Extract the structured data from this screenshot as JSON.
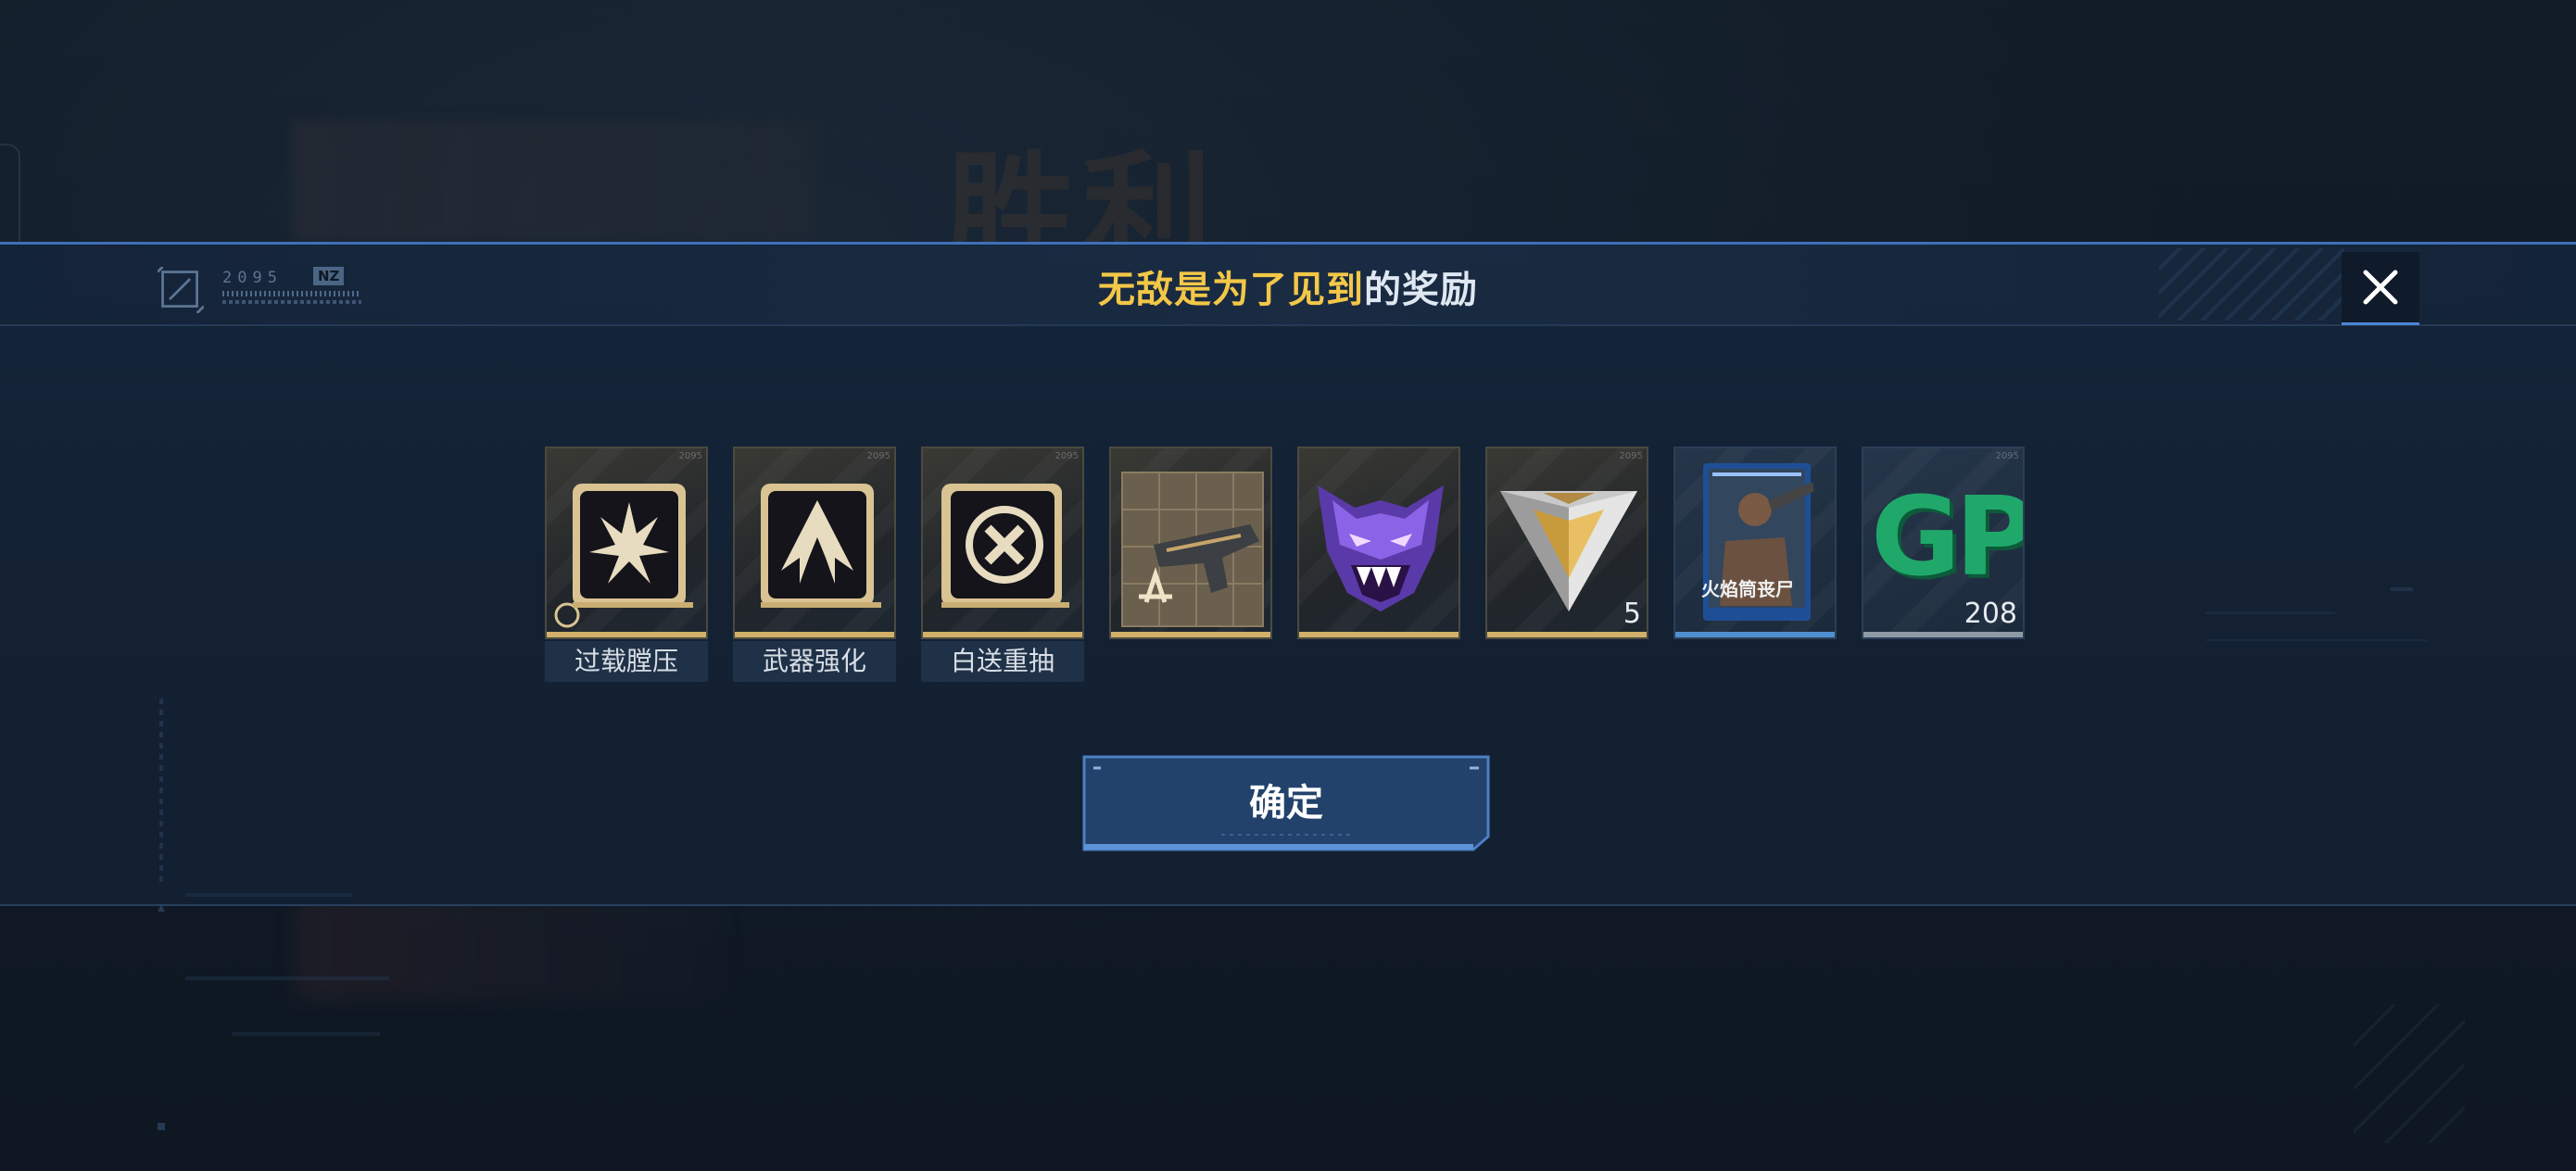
{
  "background": {
    "ghost_title": "胜利"
  },
  "modal": {
    "header": {
      "logo_code": "2095",
      "logo_tag": "NZ",
      "title_highlight": "无敌是为了见到",
      "title_rest": "的奖励",
      "close_icon": "close-x-icon"
    },
    "rewards": [
      {
        "name": "过载膛压",
        "kind": "skill-chip",
        "icon": "burst-emblem-icon",
        "quantity": "",
        "frame": "gold"
      },
      {
        "name": "武器强化",
        "kind": "skill-chip",
        "icon": "arrow-up-emblem-icon",
        "quantity": "",
        "frame": "gold"
      },
      {
        "name": "白送重抽",
        "kind": "skill-chip",
        "icon": "circle-x-emblem-icon",
        "quantity": "",
        "frame": "gold"
      },
      {
        "name": "",
        "kind": "weapon-blueprint",
        "icon": "pistol-blueprint-icon",
        "quantity": "",
        "frame": "gold"
      },
      {
        "name": "",
        "kind": "demon-mask",
        "icon": "purple-demon-mask-icon",
        "quantity": "",
        "frame": "gold"
      },
      {
        "name": "",
        "kind": "gold-prism",
        "icon": "gold-triangle-prism-icon",
        "quantity": "5",
        "frame": "gold"
      },
      {
        "name": "",
        "kind": "character-card",
        "icon": "character-card-icon",
        "card_text": "火焰筒丧尸",
        "quantity": "",
        "frame": "blue"
      },
      {
        "name": "",
        "kind": "currency",
        "icon": "gp-currency-icon",
        "currency_text": "GP",
        "quantity": "208",
        "frame": "grey"
      }
    ],
    "confirm_label": "确定"
  },
  "colors": {
    "accent_blue": "#3f6fb8",
    "title_yellow": "#f3c747",
    "gold_bar": "#d1b06a",
    "gp_green": "#1fa86a"
  }
}
